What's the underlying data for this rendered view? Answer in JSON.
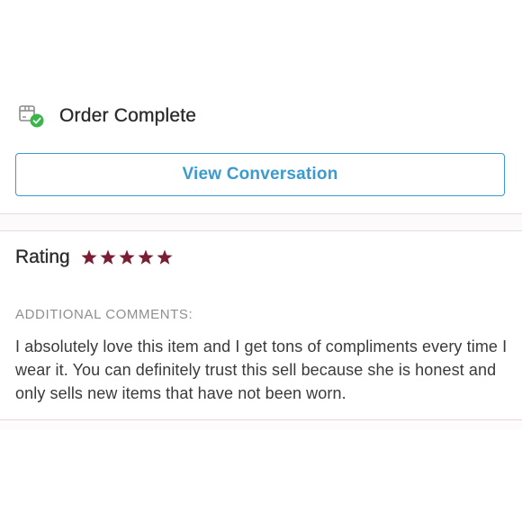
{
  "order": {
    "status_title": "Order Complete",
    "icon": "package-check-icon"
  },
  "actions": {
    "view_conversation_label": "View Conversation"
  },
  "rating": {
    "label": "Rating",
    "value": 5,
    "max": 5,
    "star_color": "#7a1e33",
    "icon": "star-icon"
  },
  "comments": {
    "heading": "ADDITIONAL COMMENTS:",
    "text": "I absolutely love this item and I get tons of compliments every time I wear it. You can definitely trust this sell because she is honest and only sells new items that have not been worn."
  },
  "colors": {
    "accent": "#3a9bd0",
    "success": "#3bb54a",
    "star": "#7a1e33"
  }
}
